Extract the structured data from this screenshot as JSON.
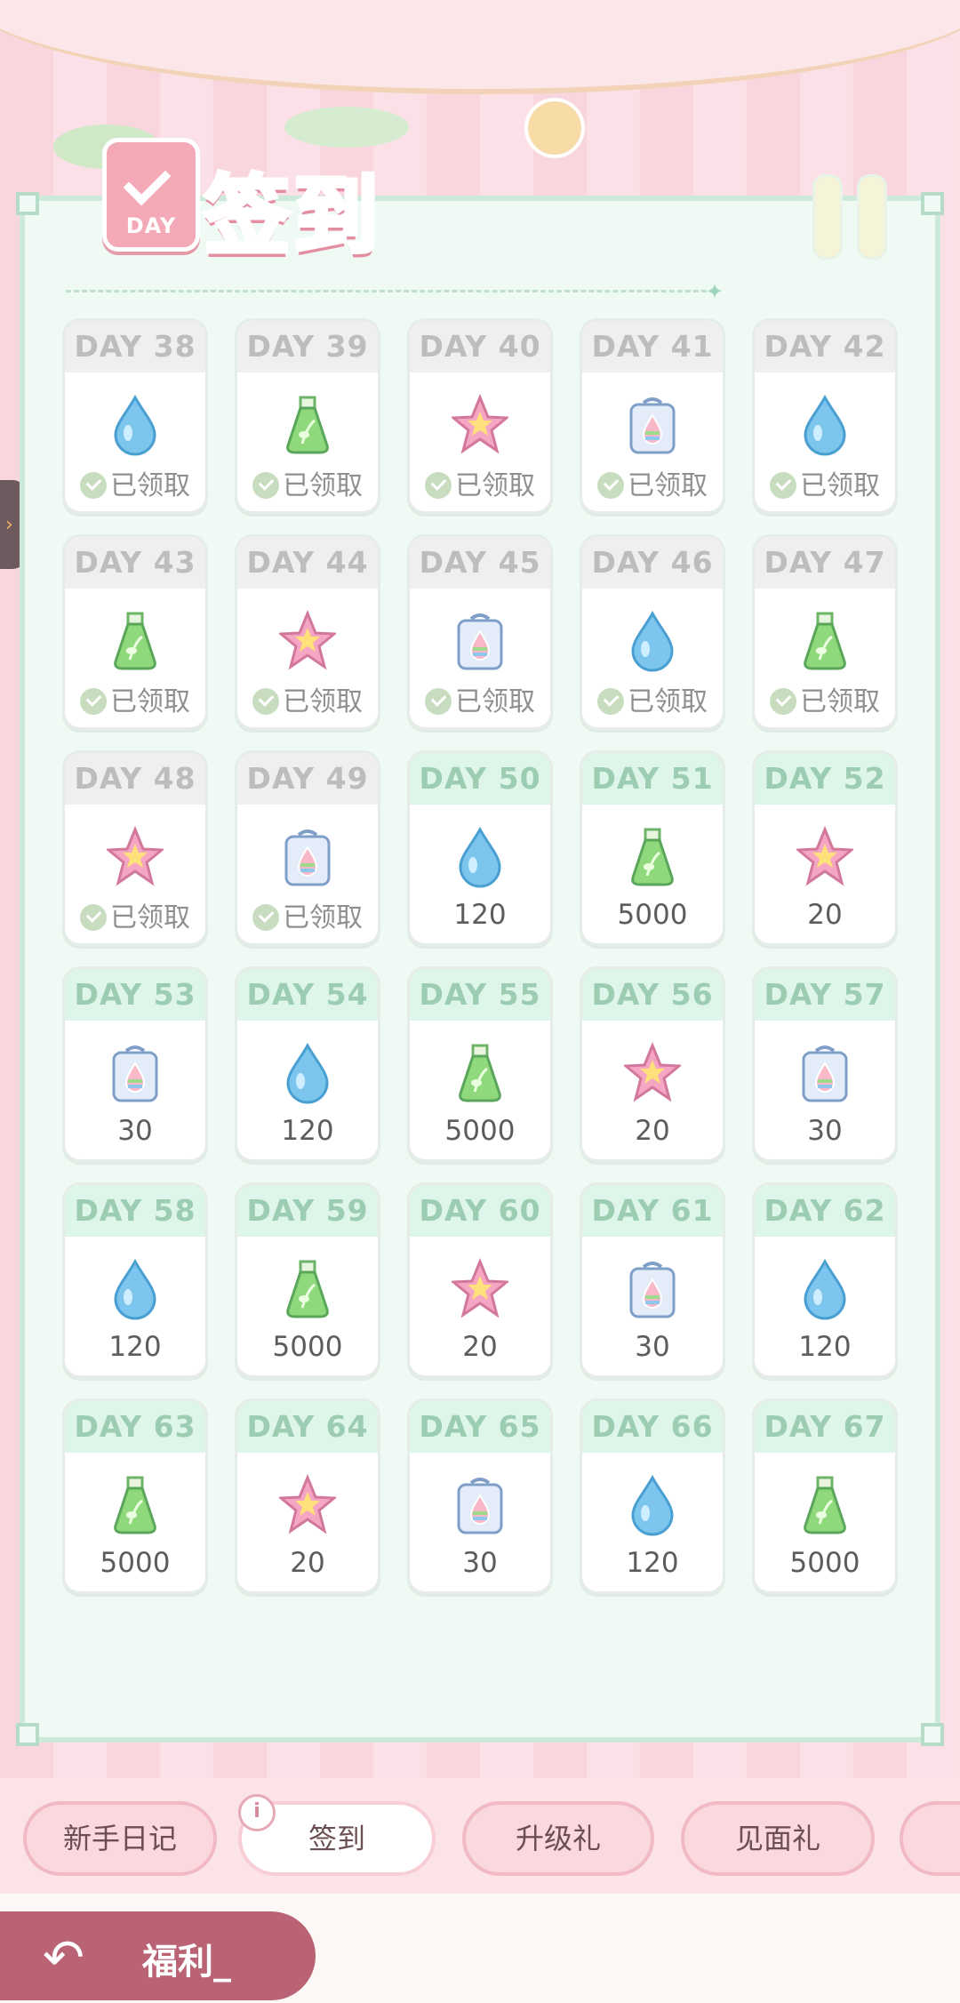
{
  "header": {
    "title": "签到",
    "calendar_label": "DAY"
  },
  "days": [
    {
      "day": "DAY 38",
      "item": "water-drop",
      "status": "已领取"
    },
    {
      "day": "DAY 39",
      "item": "potion",
      "status": "已领取"
    },
    {
      "day": "DAY 40",
      "item": "star",
      "status": "已领取"
    },
    {
      "day": "DAY 41",
      "item": "rainbow-bag",
      "status": "已领取"
    },
    {
      "day": "DAY 42",
      "item": "water-drop",
      "status": "已领取"
    },
    {
      "day": "DAY 43",
      "item": "potion",
      "status": "已领取"
    },
    {
      "day": "DAY 44",
      "item": "star",
      "status": "已领取"
    },
    {
      "day": "DAY 45",
      "item": "rainbow-bag",
      "status": "已领取"
    },
    {
      "day": "DAY 46",
      "item": "water-drop",
      "status": "已领取"
    },
    {
      "day": "DAY 47",
      "item": "potion",
      "status": "已领取"
    },
    {
      "day": "DAY 48",
      "item": "star",
      "status": "已领取"
    },
    {
      "day": "DAY 49",
      "item": "rainbow-bag",
      "status": "已领取"
    },
    {
      "day": "DAY 50",
      "item": "water-drop",
      "amount": "120"
    },
    {
      "day": "DAY 51",
      "item": "potion",
      "amount": "5000"
    },
    {
      "day": "DAY 52",
      "item": "star",
      "amount": "20"
    },
    {
      "day": "DAY 53",
      "item": "rainbow-bag",
      "amount": "30"
    },
    {
      "day": "DAY 54",
      "item": "water-drop",
      "amount": "120"
    },
    {
      "day": "DAY 55",
      "item": "potion",
      "amount": "5000"
    },
    {
      "day": "DAY 56",
      "item": "star",
      "amount": "20"
    },
    {
      "day": "DAY 57",
      "item": "rainbow-bag",
      "amount": "30"
    },
    {
      "day": "DAY 58",
      "item": "water-drop",
      "amount": "120"
    },
    {
      "day": "DAY 59",
      "item": "potion",
      "amount": "5000"
    },
    {
      "day": "DAY 60",
      "item": "star",
      "amount": "20"
    },
    {
      "day": "DAY 61",
      "item": "rainbow-bag",
      "amount": "30"
    },
    {
      "day": "DAY 62",
      "item": "water-drop",
      "amount": "120"
    },
    {
      "day": "DAY 63",
      "item": "potion",
      "amount": "5000"
    },
    {
      "day": "DAY 64",
      "item": "star",
      "amount": "20"
    },
    {
      "day": "DAY 65",
      "item": "rainbow-bag",
      "amount": "30"
    },
    {
      "day": "DAY 66",
      "item": "water-drop",
      "amount": "120"
    },
    {
      "day": "DAY 67",
      "item": "potion",
      "amount": "5000"
    }
  ],
  "tabs": [
    {
      "label": "新手日记",
      "active": false
    },
    {
      "label": "签到",
      "active": true
    },
    {
      "label": "升级礼",
      "active": false
    },
    {
      "label": "见面礼",
      "active": false
    }
  ],
  "bottom": {
    "section_label": "福利_"
  },
  "colors": {
    "accent_pink": "#f4a0b2",
    "panel_green": "#eefaf3",
    "header_green": "#def5e9",
    "welfare": "#b96374"
  }
}
